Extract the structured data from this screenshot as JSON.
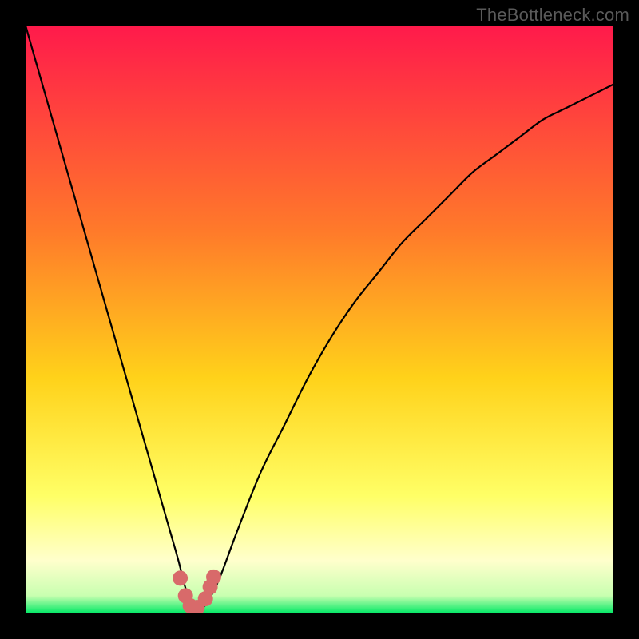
{
  "watermark": "TheBottleneck.com",
  "colors": {
    "frame": "#000000",
    "gradient_top": "#ff1a4b",
    "gradient_mid1": "#ff7a2a",
    "gradient_mid2": "#ffd21a",
    "gradient_low": "#ffff66",
    "gradient_pale": "#ffffcc",
    "gradient_bottom": "#00e865",
    "curve": "#000000",
    "marker": "#d86a6a"
  },
  "chart_data": {
    "type": "line",
    "title": "",
    "xlabel": "",
    "ylabel": "",
    "xlim": [
      0,
      100
    ],
    "ylim": [
      0,
      100
    ],
    "series": [
      {
        "name": "bottleneck-curve",
        "x": [
          0,
          2,
          4,
          6,
          8,
          10,
          12,
          14,
          16,
          18,
          20,
          22,
          24,
          26,
          27,
          28,
          29,
          30,
          31,
          33,
          36,
          40,
          44,
          48,
          52,
          56,
          60,
          64,
          68,
          72,
          76,
          80,
          84,
          88,
          92,
          96,
          100
        ],
        "y": [
          100,
          93,
          86,
          79,
          72,
          65,
          58,
          51,
          44,
          37,
          30,
          23,
          16,
          9,
          5,
          2,
          1,
          1,
          2,
          6,
          14,
          24,
          32,
          40,
          47,
          53,
          58,
          63,
          67,
          71,
          75,
          78,
          81,
          84,
          86,
          88,
          90
        ]
      }
    ],
    "markers": {
      "name": "bottleneck-highlight",
      "x": [
        26.3,
        27.2,
        28.0,
        29.2,
        30.6,
        31.4,
        32.0
      ],
      "y": [
        6.0,
        3.0,
        1.3,
        1.0,
        2.5,
        4.5,
        6.2
      ]
    },
    "gradient_stops": [
      {
        "pct": 0,
        "color": "#ff1a4b"
      },
      {
        "pct": 35,
        "color": "#ff7a2a"
      },
      {
        "pct": 60,
        "color": "#ffd21a"
      },
      {
        "pct": 80,
        "color": "#ffff66"
      },
      {
        "pct": 91,
        "color": "#ffffcc"
      },
      {
        "pct": 97,
        "color": "#c8ffb0"
      },
      {
        "pct": 100,
        "color": "#00e865"
      }
    ]
  }
}
